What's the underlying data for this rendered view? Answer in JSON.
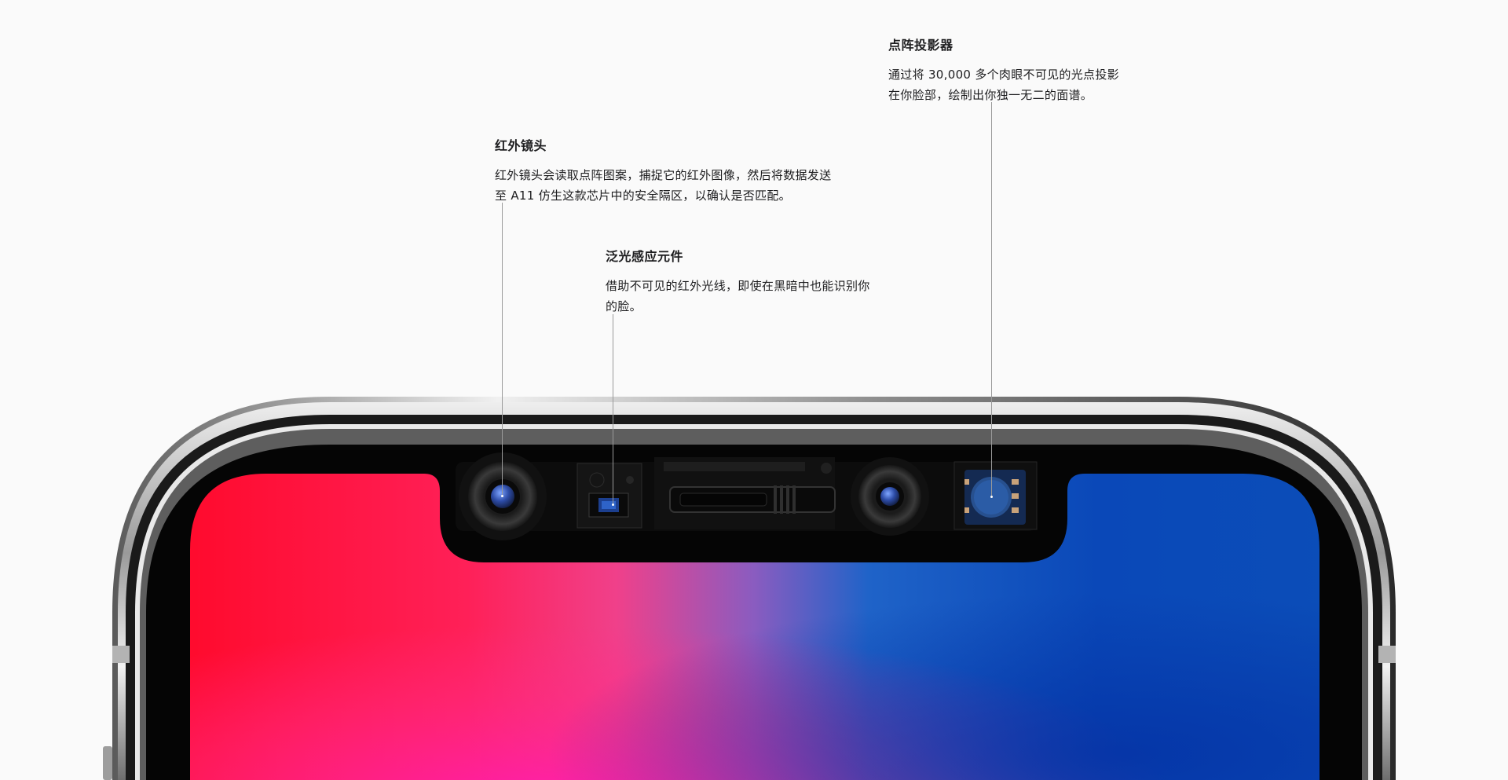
{
  "callouts": {
    "infrared_camera": {
      "title": "红外镜头",
      "line1": "红外镜头会读取点阵图案，捕捉它的红外图像，然后将数据发送",
      "line2": "至 A11 仿生这款芯片中的安全隔区，以确认是否匹配。"
    },
    "flood_illuminator": {
      "title": "泛光感应元件",
      "line1": "借助不可见的红外光线，即使在黑暗中也能识别你",
      "line2": "的脸。"
    },
    "dot_projector": {
      "title": "点阵投影器",
      "line1": "通过将 30,000 多个肉眼不可见的光点投影",
      "line2": "在你脸部，绘制出你独一无二的面谱。"
    }
  },
  "colors": {
    "background": "#fafafa",
    "screen_red": "#ff1a3a",
    "screen_pink": "#ff2a8c",
    "screen_blue": "#0a4fc4",
    "frame": "#0a0a0a",
    "steel": "#c9c9c9"
  },
  "icons": {
    "infrared_camera": "infrared-camera-icon",
    "flood_illuminator": "flood-illuminator-icon",
    "front_camera": "front-camera-icon",
    "speaker": "speaker-grille-icon",
    "dot_projector": "dot-projector-icon"
  }
}
